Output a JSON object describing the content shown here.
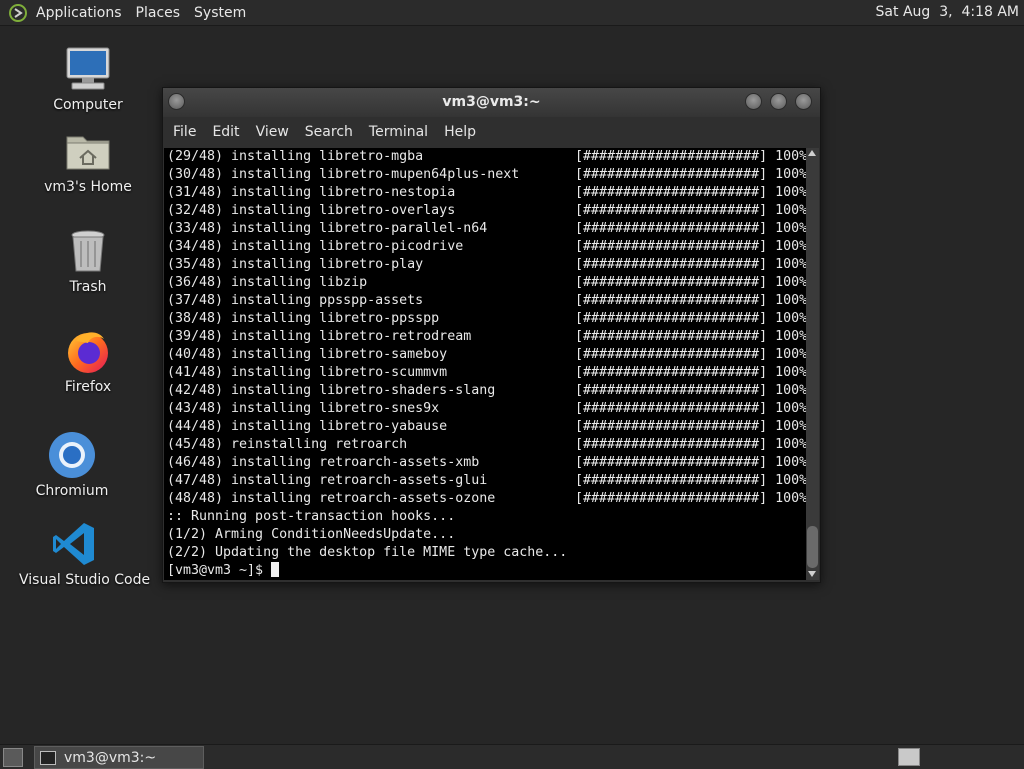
{
  "top_panel": {
    "menus": [
      "Applications",
      "Places",
      "System"
    ],
    "clock": "Sat Aug  3,  4:18 AM"
  },
  "desktop_icons": [
    {
      "label": "Computer",
      "icon": "computer-icon"
    },
    {
      "label": "vm3's Home",
      "icon": "home-folder-icon"
    },
    {
      "label": "Trash",
      "icon": "trash-icon"
    },
    {
      "label": "Firefox",
      "icon": "firefox-icon"
    },
    {
      "label": "Chromium",
      "icon": "chromium-icon"
    },
    {
      "label": "Visual Studio Code",
      "icon": "vscode-icon"
    }
  ],
  "window": {
    "title": "vm3@vm3:~",
    "menus": [
      "File",
      "Edit",
      "View",
      "Search",
      "Terminal",
      "Help"
    ]
  },
  "terminal": {
    "progress_lines": [
      {
        "text": "(29/48) installing libretro-mgba",
        "bar": "[######################] 100%"
      },
      {
        "text": "(30/48) installing libretro-mupen64plus-next",
        "bar": "[######################] 100%"
      },
      {
        "text": "(31/48) installing libretro-nestopia",
        "bar": "[######################] 100%"
      },
      {
        "text": "(32/48) installing libretro-overlays",
        "bar": "[######################] 100%"
      },
      {
        "text": "(33/48) installing libretro-parallel-n64",
        "bar": "[######################] 100%"
      },
      {
        "text": "(34/48) installing libretro-picodrive",
        "bar": "[######################] 100%"
      },
      {
        "text": "(35/48) installing libretro-play",
        "bar": "[######################] 100%"
      },
      {
        "text": "(36/48) installing libzip",
        "bar": "[######################] 100%"
      },
      {
        "text": "(37/48) installing ppsspp-assets",
        "bar": "[######################] 100%"
      },
      {
        "text": "(38/48) installing libretro-ppsspp",
        "bar": "[######################] 100%"
      },
      {
        "text": "(39/48) installing libretro-retrodream",
        "bar": "[######################] 100%"
      },
      {
        "text": "(40/48) installing libretro-sameboy",
        "bar": "[######################] 100%"
      },
      {
        "text": "(41/48) installing libretro-scummvm",
        "bar": "[######################] 100%"
      },
      {
        "text": "(42/48) installing libretro-shaders-slang",
        "bar": "[######################] 100%"
      },
      {
        "text": "(43/48) installing libretro-snes9x",
        "bar": "[######################] 100%"
      },
      {
        "text": "(44/48) installing libretro-yabause",
        "bar": "[######################] 100%"
      },
      {
        "text": "(45/48) reinstalling retroarch",
        "bar": "[######################] 100%"
      },
      {
        "text": "(46/48) installing retroarch-assets-xmb",
        "bar": "[######################] 100%"
      },
      {
        "text": "(47/48) installing retroarch-assets-glui",
        "bar": "[######################] 100%"
      },
      {
        "text": "(48/48) installing retroarch-assets-ozone",
        "bar": "[######################] 100%"
      }
    ],
    "post_lines": [
      ":: Running post-transaction hooks...",
      "(1/2) Arming ConditionNeedsUpdate...",
      "(2/2) Updating the desktop file MIME type cache..."
    ],
    "prompt": "[vm3@vm3 ~]$ "
  },
  "taskbar": {
    "task_label": "vm3@vm3:~"
  }
}
